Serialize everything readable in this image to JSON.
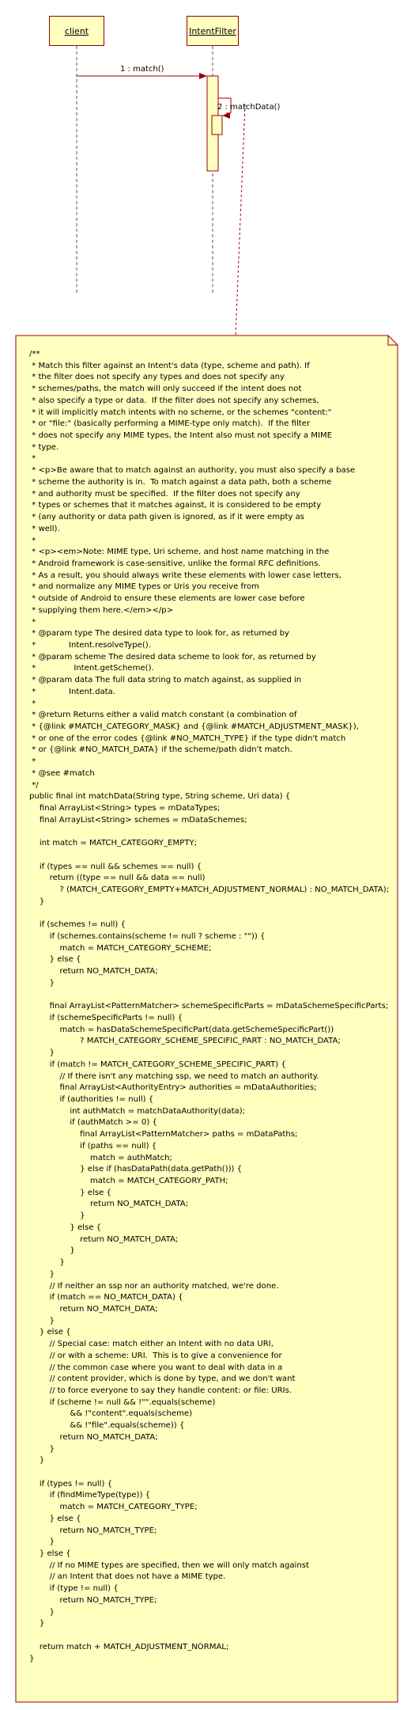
{
  "lifelines": [
    {
      "name": "client"
    },
    {
      "name": "IntentFilter"
    }
  ],
  "messages": [
    {
      "label": "1 : match()"
    },
    {
      "label": "2 : matchData()"
    }
  ],
  "note": {
    "lines": [
      "/**",
      " * Match this filter against an Intent's data (type, scheme and path). If",
      " * the filter does not specify any types and does not specify any",
      " * schemes/paths, the match will only succeed if the intent does not",
      " * also specify a type or data.  If the filter does not specify any schemes,",
      " * it will implicitly match intents with no scheme, or the schemes \"content:\"",
      " * or \"file:\" (basically performing a MIME-type only match).  If the filter",
      " * does not specify any MIME types, the Intent also must not specify a MIME",
      " * type.",
      " *",
      " * <p>Be aware that to match against an authority, you must also specify a base",
      " * scheme the authority is in.  To match against a data path, both a scheme",
      " * and authority must be specified.  If the filter does not specify any",
      " * types or schemes that it matches against, it is considered to be empty",
      " * (any authority or data path given is ignored, as if it were empty as",
      " * well).",
      " *",
      " * <p><em>Note: MIME type, Uri scheme, and host name matching in the",
      " * Android framework is case-sensitive, unlike the formal RFC definitions.",
      " * As a result, you should always write these elements with lower case letters,",
      " * and normalize any MIME types or Uris you receive from",
      " * outside of Android to ensure these elements are lower case before",
      " * supplying them here.</em></p>",
      " *",
      " * @param type The desired data type to look for, as returned by",
      " *             Intent.resolveType().",
      " * @param scheme The desired data scheme to look for, as returned by",
      " *               Intent.getScheme().",
      " * @param data The full data string to match against, as supplied in",
      " *             Intent.data.",
      " *",
      " * @return Returns either a valid match constant (a combination of",
      " * {@link #MATCH_CATEGORY_MASK} and {@link #MATCH_ADJUSTMENT_MASK}),",
      " * or one of the error codes {@link #NO_MATCH_TYPE} if the type didn't match",
      " * or {@link #NO_MATCH_DATA} if the scheme/path didn't match.",
      " *",
      " * @see #match",
      " */",
      "public final int matchData(String type, String scheme, Uri data) {",
      "    final ArrayList<String> types = mDataTypes;",
      "    final ArrayList<String> schemes = mDataSchemes;",
      "",
      "    int match = MATCH_CATEGORY_EMPTY;",
      "",
      "    if (types == null && schemes == null) {",
      "        return ((type == null && data == null)",
      "            ? (MATCH_CATEGORY_EMPTY+MATCH_ADJUSTMENT_NORMAL) : NO_MATCH_DATA);",
      "    }",
      "",
      "    if (schemes != null) {",
      "        if (schemes.contains(scheme != null ? scheme : \"\")) {",
      "            match = MATCH_CATEGORY_SCHEME;",
      "        } else {",
      "            return NO_MATCH_DATA;",
      "        }",
      "",
      "        final ArrayList<PatternMatcher> schemeSpecificParts = mDataSchemeSpecificParts;",
      "        if (schemeSpecificParts != null) {",
      "            match = hasDataSchemeSpecificPart(data.getSchemeSpecificPart())",
      "                    ? MATCH_CATEGORY_SCHEME_SPECIFIC_PART : NO_MATCH_DATA;",
      "        }",
      "        if (match != MATCH_CATEGORY_SCHEME_SPECIFIC_PART) {",
      "            // If there isn't any matching ssp, we need to match an authority.",
      "            final ArrayList<AuthorityEntry> authorities = mDataAuthorities;",
      "            if (authorities != null) {",
      "                int authMatch = matchDataAuthority(data);",
      "                if (authMatch >= 0) {",
      "                    final ArrayList<PatternMatcher> paths = mDataPaths;",
      "                    if (paths == null) {",
      "                        match = authMatch;",
      "                    } else if (hasDataPath(data.getPath())) {",
      "                        match = MATCH_CATEGORY_PATH;",
      "                    } else {",
      "                        return NO_MATCH_DATA;",
      "                    }",
      "                } else {",
      "                    return NO_MATCH_DATA;",
      "                }",
      "            }",
      "        }",
      "        // If neither an ssp nor an authority matched, we're done.",
      "        if (match == NO_MATCH_DATA) {",
      "            return NO_MATCH_DATA;",
      "        }",
      "    } else {",
      "        // Special case: match either an Intent with no data URI,",
      "        // or with a scheme: URI.  This is to give a convenience for",
      "        // the common case where you want to deal with data in a",
      "        // content provider, which is done by type, and we don't want",
      "        // to force everyone to say they handle content: or file: URIs.",
      "        if (scheme != null && !\"\".equals(scheme)",
      "                && !\"content\".equals(scheme)",
      "                && !\"file\".equals(scheme)) {",
      "            return NO_MATCH_DATA;",
      "        }",
      "    }",
      "",
      "    if (types != null) {",
      "        if (findMimeType(type)) {",
      "            match = MATCH_CATEGORY_TYPE;",
      "        } else {",
      "            return NO_MATCH_TYPE;",
      "        }",
      "    } else {",
      "        // If no MIME types are specified, then we will only match against",
      "        // an Intent that does not have a MIME type.",
      "        if (type != null) {",
      "            return NO_MATCH_TYPE;",
      "        }",
      "    }",
      "",
      "    return match + MATCH_ADJUSTMENT_NORMAL;",
      "}"
    ]
  }
}
